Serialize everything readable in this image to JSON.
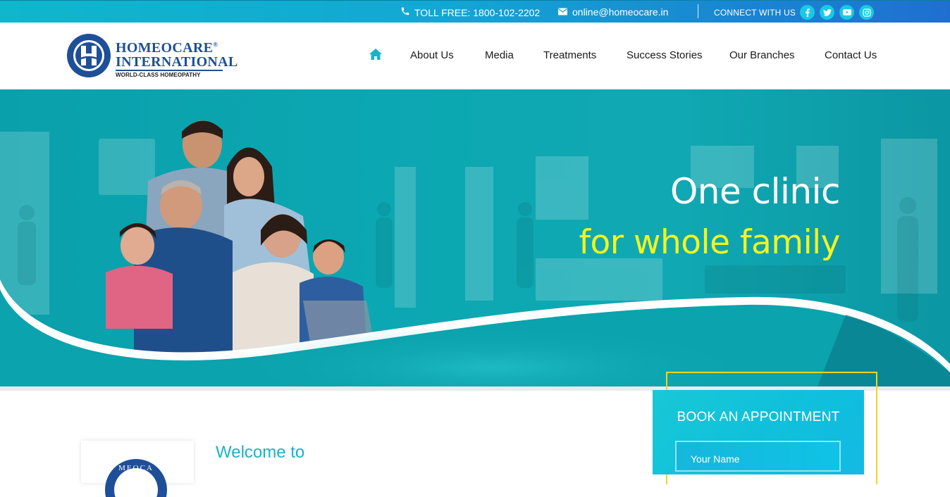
{
  "topbar": {
    "toll_free": "TOLL FREE: 1800-102-2202",
    "email": "online@homeocare.in",
    "connect_label": "CONNECT WITH US",
    "social_icons": [
      "facebook-icon",
      "twitter-icon",
      "youtube-icon",
      "instagram-icon"
    ]
  },
  "header": {
    "logo": {
      "name_line1": "HOMEOCARE",
      "name_line2": "INTERNATIONAL",
      "registered": "®",
      "tagline": "WORLD-CLASS HOMEOPATHY",
      "badge_ring_text": "HOMEOCARE INTERNATIONAL"
    },
    "nav": [
      {
        "label": "",
        "icon": "home-icon"
      },
      {
        "label": "About Us"
      },
      {
        "label": "Media"
      },
      {
        "label": "Treatments"
      },
      {
        "label": "Success Stories"
      },
      {
        "label": "Our Branches"
      },
      {
        "label": "Contact Us"
      }
    ]
  },
  "hero": {
    "headline_line1": "One clinic",
    "headline_line2": "for whole family"
  },
  "welcome": {
    "title": "Welcome to"
  },
  "appointment": {
    "title": "BOOK AN APPOINTMENT",
    "name_placeholder": "Your Name"
  },
  "colors": {
    "accent": "#19b3c9",
    "hero_teal": "#0ba7b2",
    "highlight_yellow": "#f3f51c",
    "brand_blue": "#1e4f98"
  }
}
